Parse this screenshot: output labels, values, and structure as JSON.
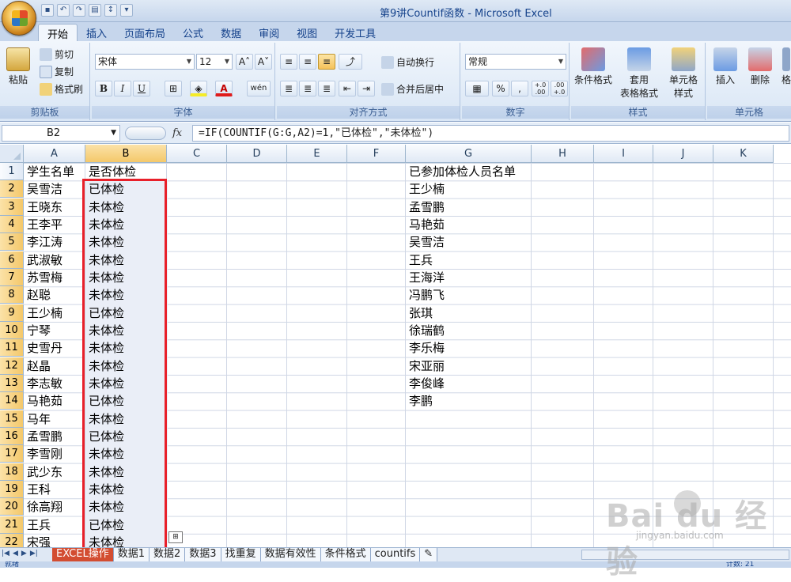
{
  "window": {
    "title": "第9讲Countif函数 - Microsoft Excel"
  },
  "ribbon_tabs": [
    "开始",
    "插入",
    "页面布局",
    "公式",
    "数据",
    "审阅",
    "视图",
    "开发工具"
  ],
  "clipboard": {
    "paste": "粘贴",
    "cut": "剪切",
    "copy": "复制",
    "format_painter": "格式刷",
    "label": "剪贴板"
  },
  "font": {
    "name": "宋体",
    "size": "12",
    "bold": "B",
    "italic": "I",
    "underline": "U",
    "label": "字体",
    "grow": "A˄",
    "shrink": "A˅",
    "font_color": "A",
    "phonetic": "wén"
  },
  "alignment": {
    "wrap": "自动换行",
    "merge": "合并后居中",
    "label": "对齐方式"
  },
  "number": {
    "format": "常规",
    "percent": "%",
    "comma": ",",
    "inc_dec": "+.0\n.00",
    "dec_dec": ".00\n+.0",
    "label": "数字"
  },
  "styles": {
    "conditional": "条件格式",
    "table_line1": "套用",
    "table_line2": "表格格式",
    "cell_line1": "单元格",
    "cell_line2": "样式",
    "label": "样式"
  },
  "cells_group": {
    "insert": "插入",
    "delete": "删除",
    "format": "格",
    "label": "单元格"
  },
  "formula_bar": {
    "name_box": "B2",
    "fx": "fx",
    "formula": "=IF(COUNTIF(G:G,A2)=1,\"已体检\",\"未体检\")"
  },
  "columns": [
    "A",
    "B",
    "C",
    "D",
    "E",
    "F",
    "G",
    "H",
    "I",
    "J",
    "K"
  ],
  "rows": [
    "1",
    "2",
    "3",
    "4",
    "5",
    "6",
    "7",
    "8",
    "9",
    "10",
    "11",
    "12",
    "13",
    "14",
    "15",
    "16",
    "17",
    "18",
    "19",
    "20",
    "21",
    "22"
  ],
  "col_a": [
    "学生名单",
    "吴雪洁",
    "王晓东",
    "王李平",
    "李江涛",
    "武淑敏",
    "苏雪梅",
    "赵聪",
    "王少楠",
    "宁琴",
    "史雪丹",
    "赵晶",
    "李志敏",
    "马艳茹",
    "马年",
    "孟雪鹏",
    "李雪刚",
    "武少东",
    "王科",
    "徐高翔",
    "王兵",
    "宋强"
  ],
  "col_b": [
    "是否体检",
    "已体检",
    "未体检",
    "未体检",
    "未体检",
    "未体检",
    "未体检",
    "未体检",
    "已体检",
    "未体检",
    "未体检",
    "未体检",
    "未体检",
    "已体检",
    "未体检",
    "已体检",
    "未体检",
    "未体检",
    "未体检",
    "未体检",
    "已体检",
    "未体检"
  ],
  "col_g": [
    "已参加体检人员名单",
    "王少楠",
    "孟雪鹏",
    "马艳茹",
    "吴雪洁",
    "王兵",
    "王海洋",
    "冯鹏飞",
    "张琪",
    "徐瑞鹤",
    "李乐梅",
    "宋亚丽",
    "李俊峰",
    "李鹏"
  ],
  "sheet_tabs": [
    "EXCEL操作",
    "数据1",
    "数据2",
    "数据3",
    "找重复",
    "数据有效性",
    "条件格式",
    "countifs"
  ],
  "status": {
    "left": "就绪",
    "count": "计数: 21"
  },
  "watermark": {
    "brand": "Bai du 经验",
    "url": "jingyan.baidu.com"
  },
  "colors": {
    "selection_outline": "#e8202a",
    "selected_header": "#f4c86a",
    "active_sheet_tab": "#d34d31"
  }
}
